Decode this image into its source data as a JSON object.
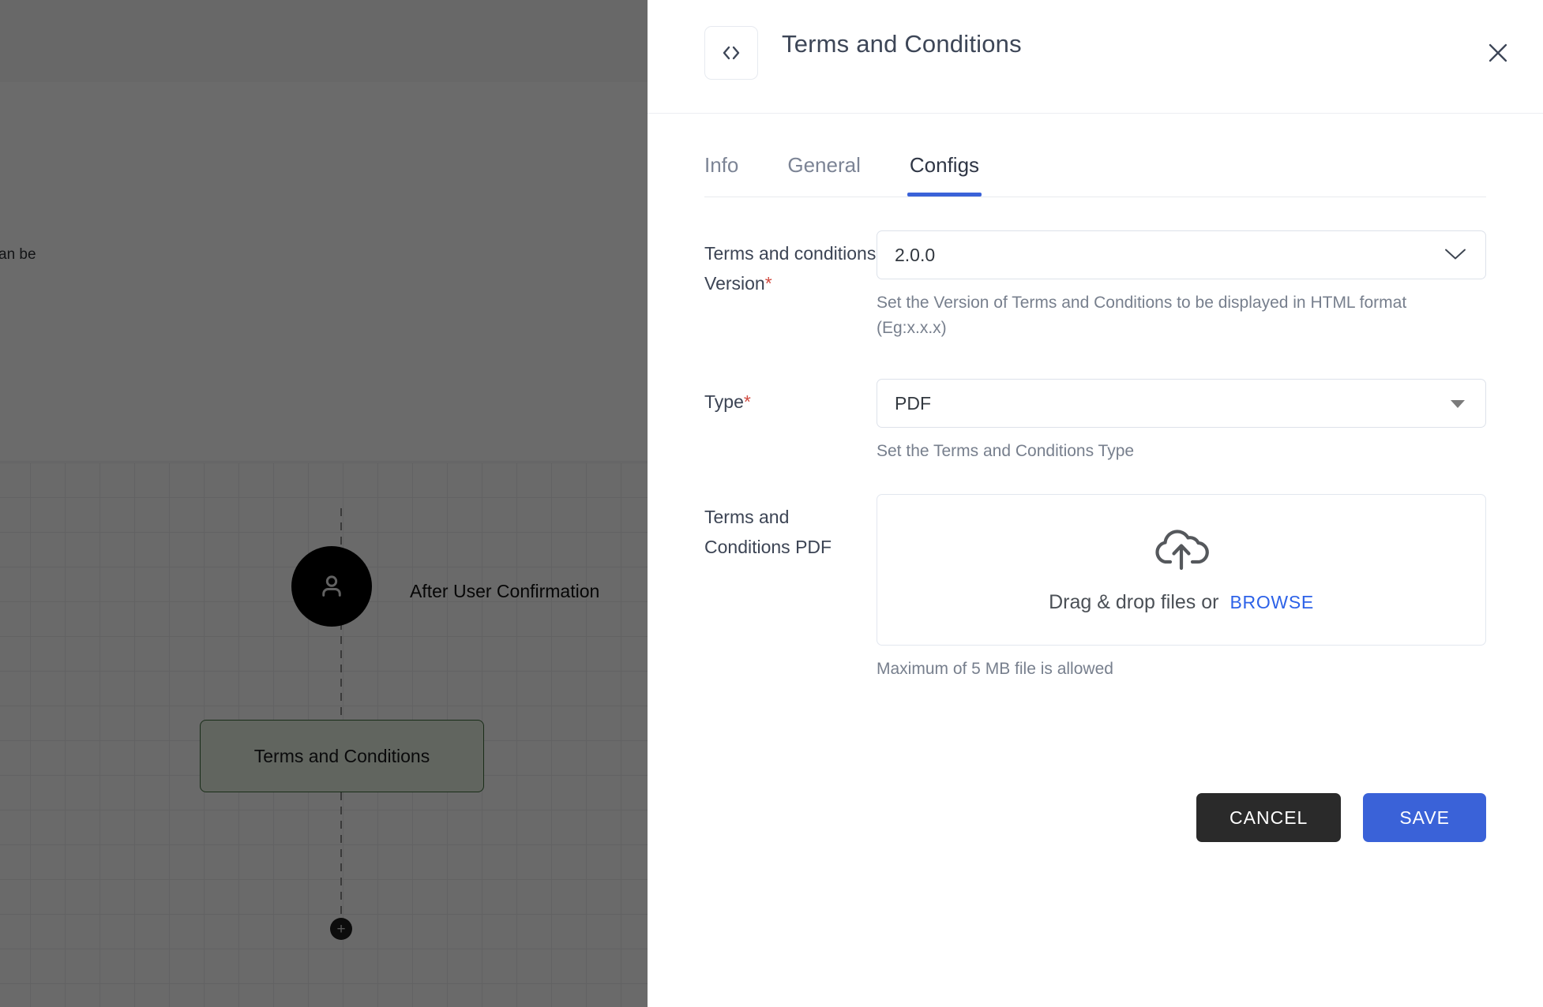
{
  "canvas": {
    "partial_text": "an be",
    "start_node_icon": "user-icon",
    "start_node_label": "After User Confirmation",
    "flow_node_label": "Terms and Conditions",
    "add_node_label": "+"
  },
  "drawer": {
    "icon": "code-brackets-icon",
    "title": "Terms and Conditions",
    "close_icon": "close-icon",
    "tabs": [
      {
        "label": "Info",
        "active": false
      },
      {
        "label": "General",
        "active": false
      },
      {
        "label": "Configs",
        "active": true
      }
    ],
    "fields": {
      "version": {
        "label": "Terms and conditions Version",
        "required": "*",
        "value": "2.0.0",
        "icon": "chevron-down-icon",
        "hint": "Set the Version of Terms and Conditions to be displayed in HTML format (Eg:x.x.x)"
      },
      "type": {
        "label": "Type",
        "required": "*",
        "value": "PDF",
        "icon": "caret-down-icon",
        "hint": "Set the Terms and Conditions Type"
      },
      "pdf": {
        "label": "Terms and Conditions PDF",
        "upload_icon": "cloud-upload-icon",
        "drop_text": "Drag & drop files or",
        "browse_label": "BROWSE",
        "hint": "Maximum of 5 MB file is allowed"
      }
    },
    "buttons": {
      "cancel": "CANCEL",
      "save": "SAVE"
    }
  },
  "colors": {
    "accent": "#3a62d8",
    "required": "#d14b41",
    "cancel_bg": "#2a2a2a",
    "node_border": "#3d6b3a",
    "title": "#3d4657"
  }
}
